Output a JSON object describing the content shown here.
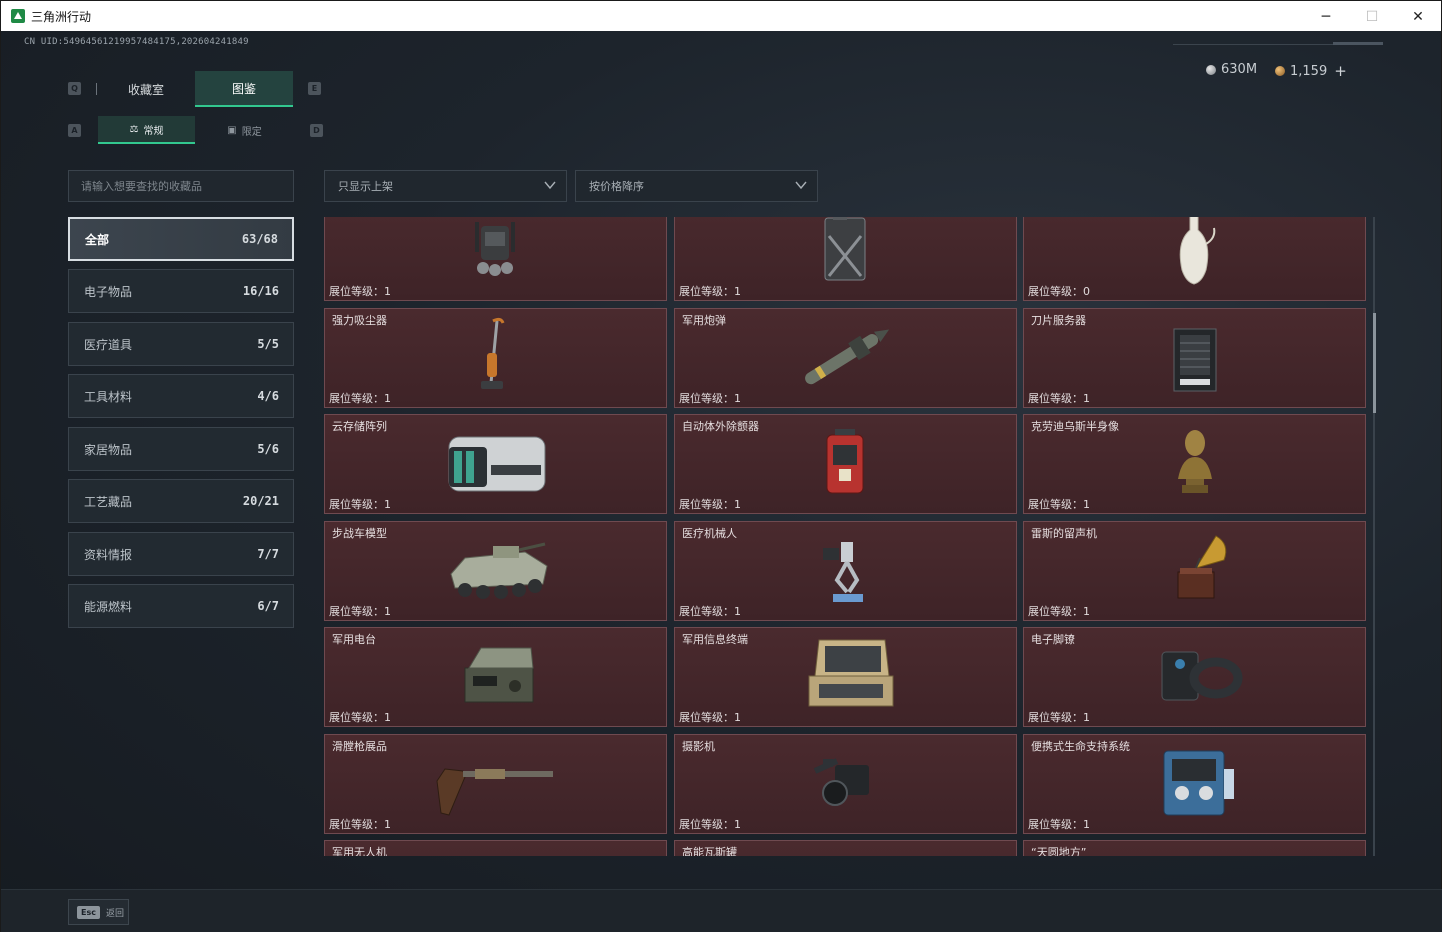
{
  "window": {
    "title": "三角洲行动",
    "minimize": "─",
    "maximize": "☐",
    "close": "✕"
  },
  "header": {
    "uid": "CN UID:5496456121995748417​5,2026042418​49"
  },
  "currency": {
    "silver": "630M",
    "gold": "1,159",
    "add": "+"
  },
  "tabs": {
    "left_key": "Q",
    "right_key": "E",
    "items": [
      {
        "label": "收藏室"
      },
      {
        "label": "图鉴"
      }
    ],
    "sub_left_key": "A",
    "sub_right_key": "D",
    "sub_items": [
      {
        "label": "常规",
        "icon": "flask-icon"
      },
      {
        "label": "限定",
        "icon": "image-icon"
      }
    ]
  },
  "search": {
    "placeholder": "请输入想要查找的收藏品"
  },
  "filters": {
    "shelf": "只显示上架",
    "sort": "按价格降序"
  },
  "categories": [
    {
      "label": "全部",
      "count": "63/68"
    },
    {
      "label": "电子物品",
      "count": "16/16"
    },
    {
      "label": "医疗道具",
      "count": "5/5"
    },
    {
      "label": "工具材料",
      "count": "4/6"
    },
    {
      "label": "家居物品",
      "count": "5/6"
    },
    {
      "label": "工艺藏品",
      "count": "20/21"
    },
    {
      "label": "资料情报",
      "count": "7/7"
    },
    {
      "label": "能源燃料",
      "count": "6/7"
    }
  ],
  "items": [
    {
      "name": "",
      "level": "展位等级：1",
      "icon": "backpack-device-icon"
    },
    {
      "name": "",
      "level": "展位等级：1",
      "icon": "jerrycan-icon"
    },
    {
      "name": "",
      "level": "展位等级：0",
      "icon": "vase-icon"
    },
    {
      "name": "强力吸尘器",
      "level": "展位等级：1",
      "icon": "vacuum-icon"
    },
    {
      "name": "军用炮弹",
      "level": "展位等级：1",
      "icon": "missile-icon"
    },
    {
      "name": "刀片服务器",
      "level": "展位等级：1",
      "icon": "server-icon"
    },
    {
      "name": "云存储阵列",
      "level": "展位等级：1",
      "icon": "storage-array-icon"
    },
    {
      "name": "自动体外除颤器",
      "level": "展位等级：1",
      "icon": "defibrillator-icon"
    },
    {
      "name": "克劳迪乌斯半身像",
      "level": "展位等级：1",
      "icon": "bust-icon"
    },
    {
      "name": "步战车模型",
      "level": "展位等级：1",
      "icon": "ifv-model-icon"
    },
    {
      "name": "医疗机械人",
      "level": "展位等级：1",
      "icon": "medical-robot-icon"
    },
    {
      "name": "雷斯的留声机",
      "level": "展位等级：1",
      "icon": "gramophone-icon"
    },
    {
      "name": "军用电台",
      "level": "展位等级：1",
      "icon": "radio-icon"
    },
    {
      "name": "军用信息终端",
      "level": "展位等级：1",
      "icon": "terminal-icon"
    },
    {
      "name": "电子脚镣",
      "level": "展位等级：1",
      "icon": "ankle-monitor-icon"
    },
    {
      "name": "滑膛枪展品",
      "level": "展位等级：1",
      "icon": "musket-icon"
    },
    {
      "name": "摄影机",
      "level": "展位等级：1",
      "icon": "camera-icon"
    },
    {
      "name": "便携式生命支持系统",
      "level": "展位等级：1",
      "icon": "life-support-icon"
    },
    {
      "name": "军用无人机",
      "level": "",
      "icon": "drone-icon"
    },
    {
      "name": "高能瓦斯罐",
      "level": "",
      "icon": "gas-tank-icon"
    },
    {
      "name": "“天圆地方”",
      "level": "",
      "icon": "coin-icon"
    }
  ],
  "footer": {
    "esc_key": "Esc",
    "esc_label": "返回"
  }
}
